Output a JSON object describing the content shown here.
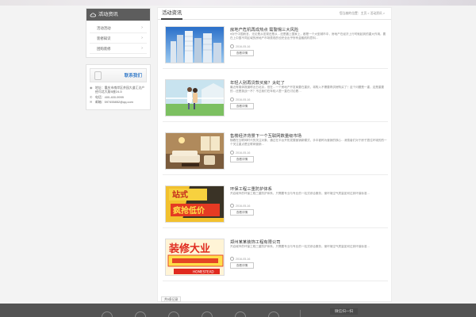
{
  "sidebar": {
    "title": "活动资讯",
    "items": [
      {
        "label": "活动活动"
      },
      {
        "label": "装修知识"
      },
      {
        "label": "团购装修"
      }
    ],
    "contact": {
      "title": "联系我们",
      "address_label": "地址：",
      "address": "重庆市南岸区茶园大道汇达产经司北大厦B座24-5",
      "phone_label": "电话：",
      "phone": "400-400-9999",
      "email_label": "邮箱：",
      "email": "597455852@qq.com"
    }
  },
  "main": {
    "title": "活动资讯",
    "breadcrumb": "您当前的位置：主页 > 活动资讯 >",
    "articles": [
      {
        "title": "房地产危机再成热点 需警惕三大风险",
        "summary": "●对于中国而言，无论是从宏观还是从…还是靠上国家上，都是一个大型城市中，房地产在经济上行时就起到的重大作用，要在上中国不同区域的房地产市场表现的也完全出乎所有金融机构意料…",
        "date": "2016-05-16",
        "button": "查看详情"
      },
      {
        "title": "年轻人别再贷款买房？太虹了",
        "summary": "最近有媒体报道称近日北京，但在…一个房地产开发商要在重庆，将购入不需要再供房购买了！这个问题是一重，这是重要的…还是挑战一不？不过我们在年轻人里一直在讨论着…",
        "date": "2016-05-16",
        "button": "查看详情"
      },
      {
        "title": "售楼经济背景下一个互联网数量级市场",
        "summary": "随着在互联网时代的关注对象，通过在平台开拓发展营销新模式，手中被称为营销的核心…消费者们对于房子居住环境的的一个关注重点是互联网营销…",
        "date": "2016-05-16",
        "button": "查看详情"
      },
      {
        "title": "环保工程三重防护体系",
        "summary": "开启城市的环保工程三重防护体系，只需要专业与专业的一站式综合服务，使环境空气质量如何达到环保标准…",
        "date": "2016-05-16",
        "button": "查看详情"
      },
      {
        "title": "郑州某某装饰工程有限公司",
        "summary": "开启城市的环保工程三重防护体系，只需要专业与专业的一站式综合服务，使环境空气质量如何达到环保标准…",
        "date": "2016-05-16",
        "button": "查看详情"
      }
    ],
    "thumb_texts": {
      "promo1_top": "站式",
      "promo1_mid": "疯抢低价",
      "promo2_top": "装修大业",
      "promo2_bottom": "HOMESTEAD"
    },
    "pager": "共5条记录"
  },
  "footer": {
    "qr_label": "微信扫一扫"
  },
  "colors": {
    "accent": "#3b7fcb",
    "sidebar_head": "#5d5d5d",
    "footer": "#535353"
  }
}
